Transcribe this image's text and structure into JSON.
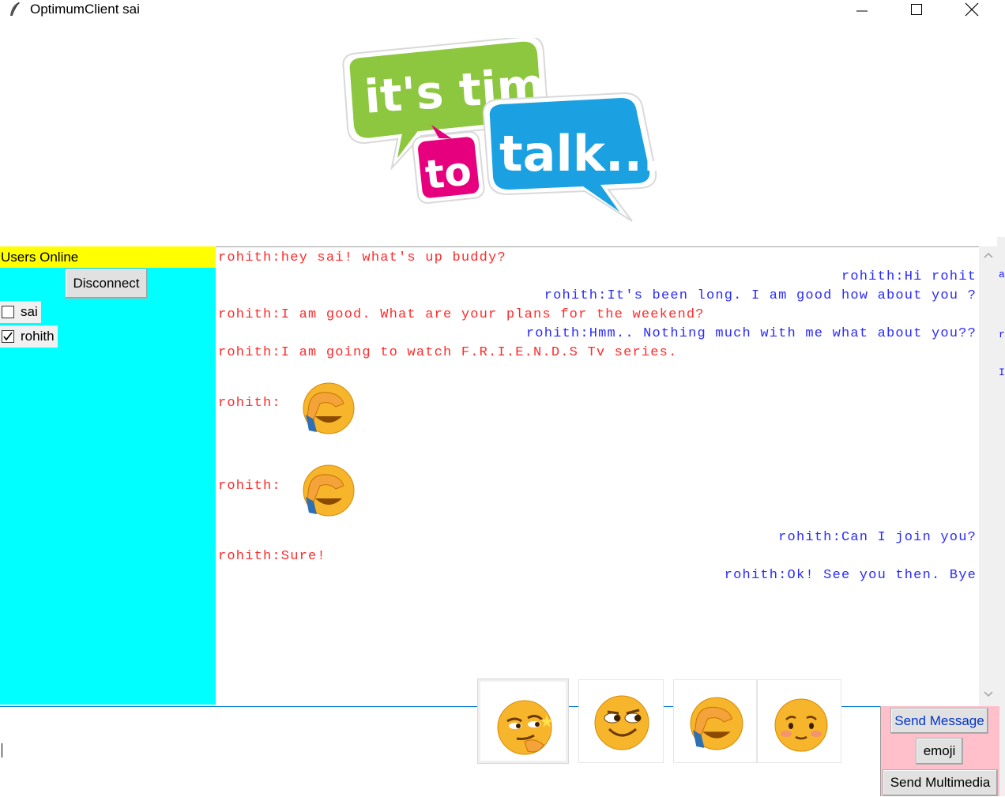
{
  "window": {
    "title": "OptimumClient sai",
    "controls": {
      "minimize": "minimize",
      "maximize": "maximize",
      "close": "close"
    }
  },
  "logo": {
    "line1": "it's time",
    "line2a": "to",
    "line2b": "talk...",
    "colors": {
      "green": "#8dc63f",
      "pink": "#e6007e",
      "blue": "#1ba1e2"
    }
  },
  "users_panel": {
    "header": "Users Online",
    "disconnect_label": "Disconnect",
    "users": [
      {
        "name": "sai",
        "checked": false
      },
      {
        "name": "rohith",
        "checked": true
      }
    ],
    "colors": {
      "background": "#00ffff",
      "header": "#ffff00"
    }
  },
  "chat": {
    "messages": [
      {
        "side": "left",
        "text": "rohith:hey sai! what's up buddy?"
      },
      {
        "side": "right",
        "text": "rohith:Hi rohit"
      },
      {
        "side": "right",
        "text": "rohith:It's been long. I am good how about you ?"
      },
      {
        "side": "left",
        "text": "rohith:I am good. What are your plans for the weekend?"
      },
      {
        "side": "right",
        "text": "rohith:Hmm.. Nothing much with me what about you??"
      },
      {
        "side": "left",
        "text": "rohith:I am going to watch F.R.I.E.N.D.S Tv series."
      },
      {
        "side": "left",
        "text": "rohith: ",
        "emoji": "facepalm"
      },
      {
        "side": "left",
        "text": "rohith: ",
        "emoji": "facepalm"
      },
      {
        "side": "right",
        "text": "rohith:Can I join you?"
      },
      {
        "side": "left",
        "text": "rohith:Sure!"
      },
      {
        "side": "right",
        "text": "rohith:Ok! See you then. Bye"
      }
    ],
    "colors": {
      "incoming": "#ff2a2a",
      "outgoing": "#2a2aff"
    }
  },
  "edge_fragments": [
    "a",
    "r",
    "I"
  ],
  "input": {
    "value": ""
  },
  "emoji_picker": [
    {
      "name": "smirk-thinking"
    },
    {
      "name": "side-eye"
    },
    {
      "name": "facepalm"
    },
    {
      "name": "blush"
    }
  ],
  "actions": {
    "send_message": "Send Message",
    "emoji": "emoji",
    "send_multimedia": "Send Multimedia",
    "colors": {
      "panel": "#ffc0cb"
    }
  }
}
